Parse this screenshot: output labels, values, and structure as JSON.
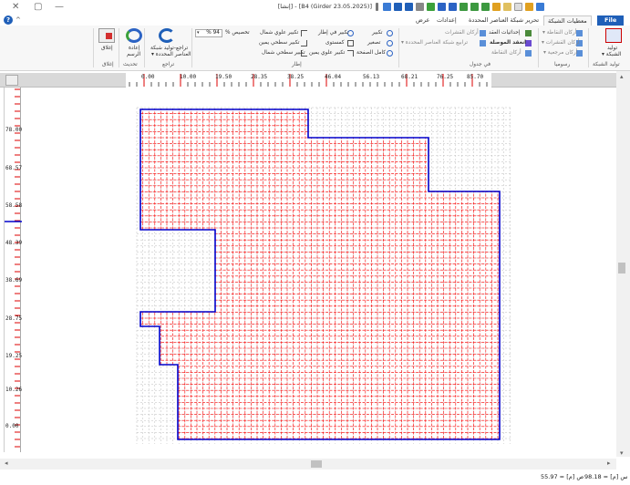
{
  "window": {
    "title": "[B4 (Girder 23.05.2025)] - [إنشا]",
    "close_glyph": "✕",
    "restore_glyph": "▢",
    "minimize_glyph": "—"
  },
  "tabs": [
    {
      "label": "File",
      "active": false
    },
    {
      "label": "معطيات الشبكة",
      "active": true
    },
    {
      "label": "تحرير شبكة العناصر المحددة",
      "active": false
    },
    {
      "label": "إعدادات",
      "active": false
    },
    {
      "label": "عرض",
      "active": false
    }
  ],
  "help_glyph": "?",
  "collapse_glyph": "^",
  "ribbon": {
    "mesh_gen": {
      "label": "توليد الشبكة",
      "button_line1": "توليد",
      "button_line2": "الشبكة ▾"
    },
    "graphics": {
      "label": "رسوميا",
      "items": [
        "أركان النقاطة ▾",
        "أركان القشرات ▾",
        "أركان مرجعية ▾"
      ]
    },
    "table": {
      "label": "في جدول",
      "items": [
        "إحداثيات العقد",
        "أركان القشرات",
        "انعقد الموصلة",
        "ترابيع شبكة العناصر المحددة ▾",
        "أركان النقاطة"
      ]
    },
    "frame": {
      "label": "إطار",
      "zoom_in": "تكبير",
      "zoom_out": "تصغير",
      "full_page": "كامل الصفحة",
      "zoom_window": "تكبير في إطار",
      "fit": "كمستوى",
      "zoom_up_right": "تكبير علوي يمين",
      "zoom_up_left": "تكبير علوي شمال",
      "zoom_down_right": "تكبير سطحي يمين",
      "zoom_down_left": "تكبير سطحي شمال",
      "custom_label": "تخصيص %",
      "custom_value": "% 94"
    },
    "undo": {
      "label": "تراجع",
      "button_line1": "تراجع-توليد شبكة",
      "button_line2": "العناصر المحددة ▾"
    },
    "refresh": {
      "label": "تحديث",
      "button_line1": "إعادة",
      "button_line2": "الرسم"
    },
    "close": {
      "label": "إغلاق",
      "button": "إغلاق"
    }
  },
  "hruler": {
    "labels": [
      "0.00",
      "10.00",
      "19.50",
      "28.35",
      "38.25",
      "46.04",
      "56.13",
      "68.21",
      "76.25",
      "85.70"
    ]
  },
  "vruler": {
    "labels": [
      "78.00",
      "68.57",
      "58.58",
      "48.39",
      "38.69",
      "28.75",
      "19.25",
      "10.26",
      "0.00"
    ]
  },
  "colors": {
    "outline": "#0000cc",
    "mesh": "#ff0000",
    "ghost_mesh": "#bbbbbb",
    "file_tab": "#1f5fb8"
  },
  "status": {
    "x": "س [م] = 98.18",
    "y": "ص [م] = 55.97"
  }
}
